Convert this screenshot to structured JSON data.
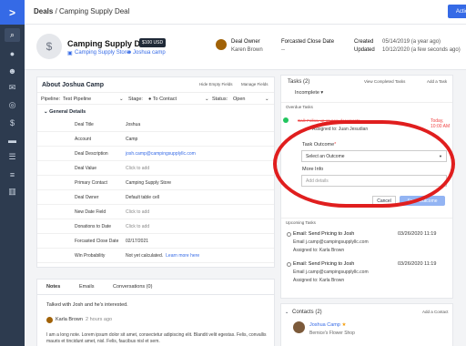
{
  "app": {
    "logo": ">",
    "breadcrumb_root": "Deals",
    "breadcrumb_sep": " / ",
    "breadcrumb_current": "Camping Supply Deal",
    "actions_label": "Actions ▾"
  },
  "sidebar": {
    "icons": [
      "search-icon",
      "location-icon",
      "contacts-icon",
      "mail-icon",
      "automations-icon",
      "deals-icon",
      "conversations-icon",
      "lists-icon",
      "reports-icon"
    ]
  },
  "header": {
    "title": "Camping Supply Deal",
    "value": "$100 USD",
    "store": "Camping Supply Store",
    "person": "Joshua camp",
    "owner_label": "Deal Owner",
    "owner_value": "Karen Brown",
    "close_label": "Forcasted Close Date",
    "close_value": "--",
    "created_label": "Created",
    "created_value": "05/14/2019 (a year ago)",
    "updated_label": "Updated",
    "updated_value": "10/12/2020 (a few seconds ago)"
  },
  "about": {
    "title": "About Joshua Camp",
    "hide_empty": "Hide Empty Fields",
    "manage": "Manage Fields",
    "pipeline_label": "Pipeline:",
    "pipeline_value": "Test Pipeline",
    "stage_label": "Stage:",
    "stage_value": "● To Contact",
    "status_label": "Status:",
    "status_value": "Open",
    "section": "General Details",
    "fields": [
      {
        "label": "Deal Title",
        "value": "Joshua",
        "kind": "text"
      },
      {
        "label": "Account",
        "value": "Camp",
        "kind": "text"
      },
      {
        "label": "Deal Description",
        "value": "josh.camp@campingsupplyllc.com",
        "kind": "link"
      },
      {
        "label": "Deal Value",
        "value": "Click to add",
        "kind": "muted"
      },
      {
        "label": "Primary Contact",
        "value": "Camping Supply Store",
        "kind": "text"
      },
      {
        "label": "Deal Owner",
        "value": "Default table cell",
        "kind": "text"
      },
      {
        "label": "New Date Field",
        "value": "Click to add",
        "kind": "muted"
      },
      {
        "label": "Donations to Date",
        "value": "Click to add",
        "kind": "muted"
      },
      {
        "label": "Forcasted Close Date",
        "value": "02/17/2021",
        "kind": "text"
      },
      {
        "label": "Win Probability",
        "value": "Not yet calculated.",
        "extra": "Learn more here",
        "kind": "text"
      }
    ]
  },
  "notes": {
    "tabs": [
      "Notes",
      "Emails",
      "Conversations (0)"
    ],
    "text": "Talked with Josh and he's interested.",
    "author": "Karla Brown",
    "time": "2 hours ago",
    "lorem": "I am a long note. Lorem ipsum dolor sit amet, consectetur adipiscing elit. Blandit velit egestas. Felis, convallis mauris et tincidunt amet, nisl. Felis, faucibus nisl et sem."
  },
  "tasks": {
    "title": "Tasks (2)",
    "view_completed": "View Completed Tasks",
    "add": "Add a Task",
    "filter": "Incomplete ▾",
    "overdue_label": "Overdue Tasks",
    "completed_task": "Call: Follow up on new documents",
    "completed_due": "Today, 10:00 AM",
    "assigned": "Assigned to: Juan Jesudian",
    "outcome_label": "Task Outcome",
    "outcome_placeholder": "Select an Outcome",
    "more_info_label": "More Info",
    "more_info_placeholder": "Add details",
    "cancel": "Cancel",
    "save": "Save Outcome",
    "upcoming_label": "Upcoming Tasks",
    "upcoming": [
      {
        "name": "Email: Send Pricing to Josh",
        "date": "03/26/2020 11:19",
        "email": "Email j.camp@campingsupplyllc.com",
        "assign": "Assigned to: Karla Brown"
      },
      {
        "name": "Email: Send Pricing to Josh",
        "date": "03/26/2020 11:19",
        "email": "Email j.camp@campingsupplyllc.com",
        "assign": "Assigned to: Karla Brown"
      }
    ]
  },
  "contacts": {
    "title": "Contacts (2)",
    "add": "Add a Contact",
    "name": "Joshua Camp",
    "star": "★",
    "sub": "Bernice's Flower Shop"
  },
  "colors": {
    "accent": "#356ae6",
    "sidebar": "#2d3b4f",
    "overdue": "#ef4444",
    "annotation": "#e01e1e"
  }
}
